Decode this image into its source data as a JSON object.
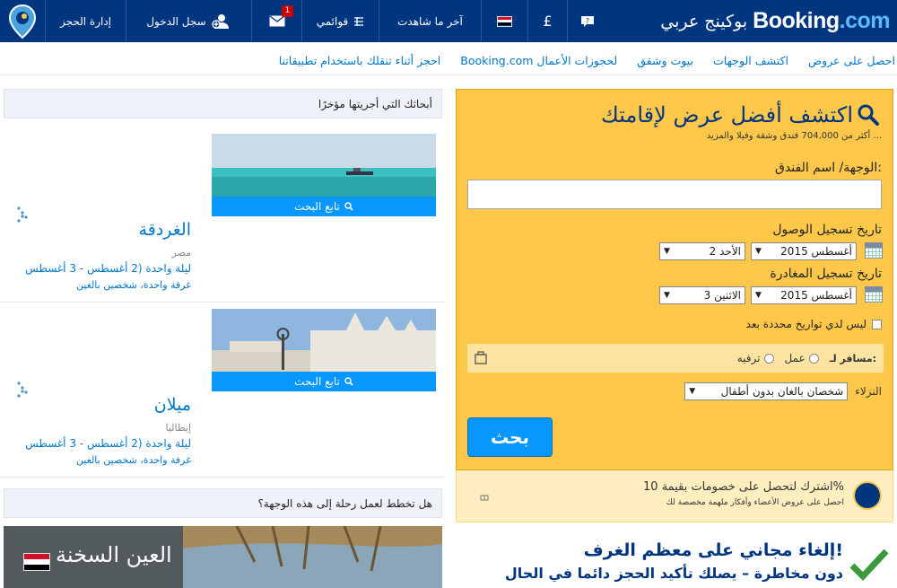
{
  "header": {
    "brand_booking": "Booking",
    "brand_dot": ".",
    "brand_com": "com",
    "brand_arabic": "بوكينج عربي",
    "currency": "£",
    "recently_viewed": "آخر ما شاهدت",
    "my_lists": "قوائمي",
    "messages_count": "1",
    "sign_in": "سجل الدخول",
    "manage_booking": "إدارة الحجز"
  },
  "subnav": {
    "items": [
      "احصل على عروض",
      "اكتشف الوجهات",
      "بيوت وشقق",
      "Booking.com لحجوزات الأعمال",
      "احجز أثناء تنقلك باستخدام تطبيقاتنا"
    ]
  },
  "search": {
    "title": "اكتشف أفضل عرض لإقامتك",
    "subtitle": "أكثر من 704,000 فندق وشقة وفيلا والمزيد ...",
    "destination_label": "الوجهة/ اسم الفندق:",
    "destination_value": "",
    "checkin_label": "تاريخ تسجيل الوصول",
    "checkin_month": "أغسطس 2015",
    "checkin_day": "الأحد 2",
    "checkout_label": "تاريخ تسجيل المغادرة",
    "checkout_month": "أغسطس 2015",
    "checkout_day": "الاثنين 3",
    "no_dates_label": "ليس لدي تواريخ محددة بعد",
    "traveling_for": "مسافر لـ:",
    "work": "عمل",
    "leisure": "ترفيه",
    "guests_label": "النزلاء",
    "guests_value": "شخصان بالغان بدون أطفال",
    "search_button": "بحث"
  },
  "promo": {
    "line1": "اشترك لتحصل على خصومات بقيمة 10%",
    "line2": "احصل على عروض الأعضاء وأفكار ملهمة مخصصة لك"
  },
  "free_cancel": {
    "heading": "إلغاء مجاني على معظم الغرف!",
    "subheading": "دون مخاطرة – يصلك تأكيد الحجز دائما في الحال"
  },
  "recent": {
    "heading": "أبحاثك التي أجريتها مؤخرًا",
    "continue_label": "تابع البحث",
    "cards": [
      {
        "city": "الغردقة",
        "country": "مصر",
        "dates": "ليلة واحدة (2 أغسطس - 3 أغسطس",
        "guests": "غرفة واحدة، شخصين بالغين"
      },
      {
        "city": "ميلان",
        "country": "إيطاليا",
        "dates": "ليلة واحدة (2 أغسطس - 3 أغسطس",
        "guests": "غرفة واحدة، شخصين بالغين"
      }
    ]
  },
  "plan": {
    "heading": "هل تخطط لعمل رحلة إلى هذه الوجهة؟",
    "destination": "العين السخنة"
  },
  "colors": {
    "header_bg": "#003580",
    "search_bg": "#fdc84a",
    "button_blue": "#0896ff",
    "link_blue": "#0077cc"
  }
}
